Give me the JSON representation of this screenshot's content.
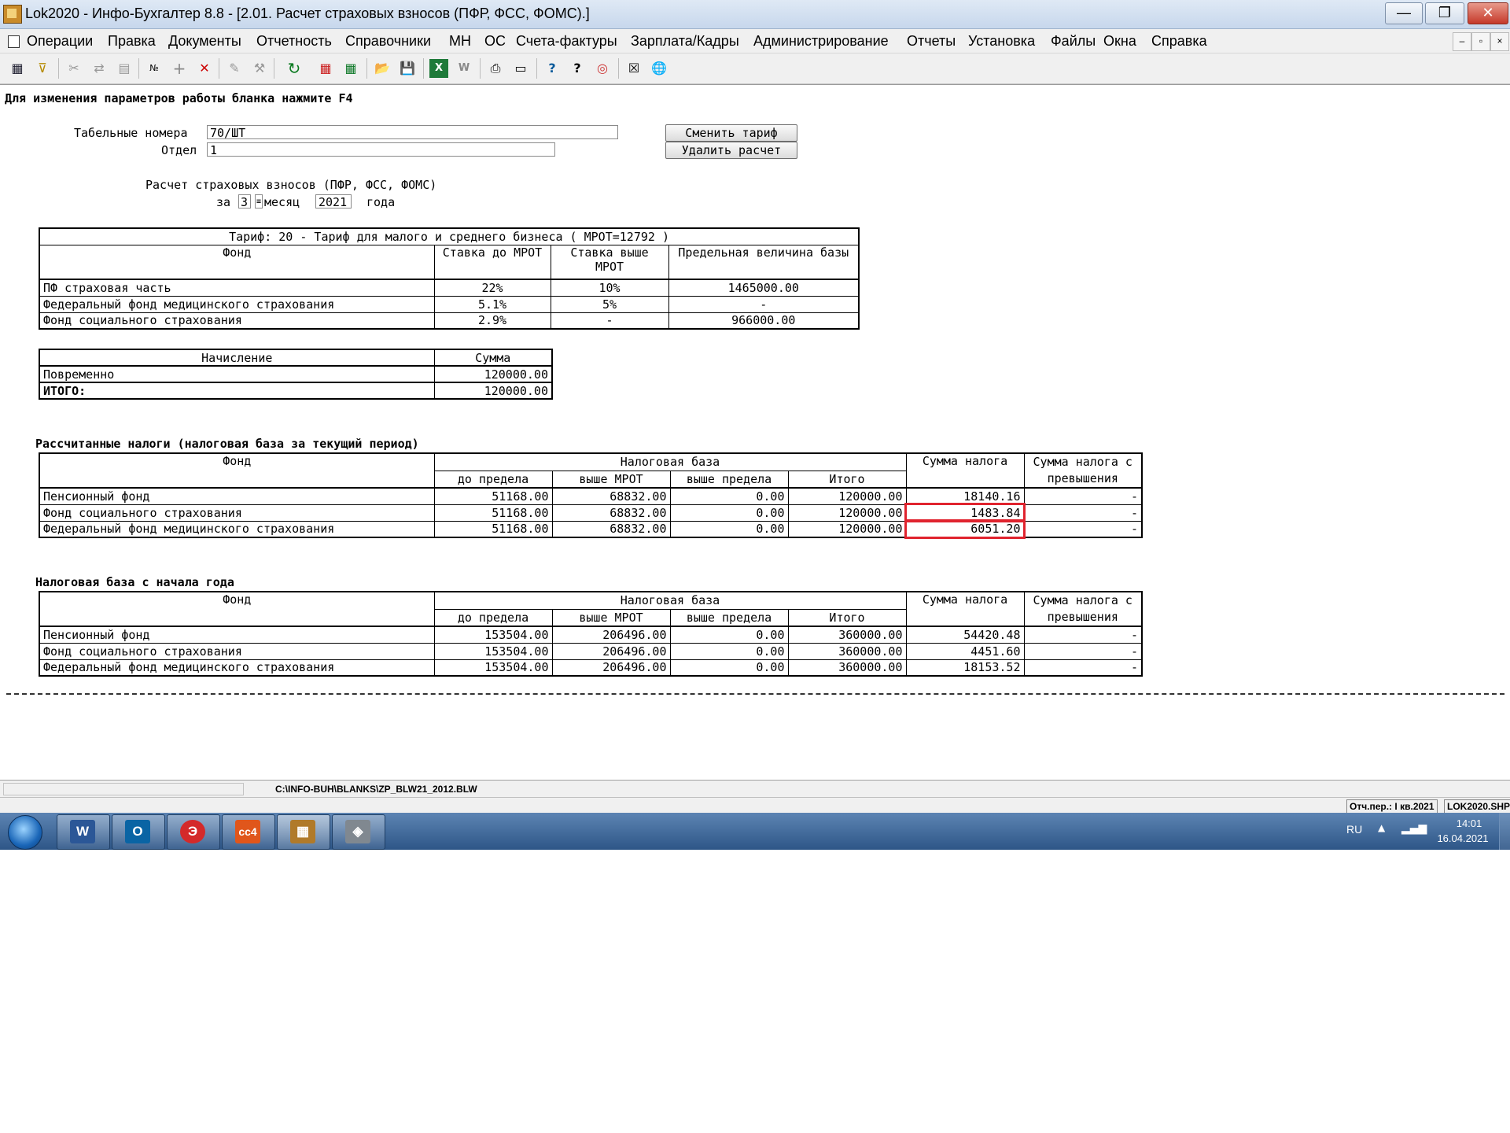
{
  "window": {
    "title": "Lok2020 - Инфо-Бухгалтер 8.8 - [2.01.   Расчет страховых взносов (ПФР, ФСС, ФОМС).]",
    "min_glyph": "—",
    "max_glyph": "❐",
    "close_glyph": "✕"
  },
  "menu": {
    "items": [
      "Операции",
      "Правка",
      "Документы",
      "Отчетность",
      "Справочники",
      "МН",
      "ОС",
      "Счета-фактуры",
      "Зарплата/Кадры",
      "Администрирование",
      "Отчеты",
      "Установка",
      "Файлы",
      "Окна",
      "Справка"
    ],
    "mdi": [
      "–",
      "▫",
      "×"
    ]
  },
  "toolbar": {
    "icons": [
      "grid-icon",
      "filter-icon",
      "cut-icon",
      "move-icon",
      "paste-icon",
      "number-icon",
      "add-icon",
      "delete-icon",
      "tool-a-icon",
      "tool-b-icon",
      "refresh-icon",
      "calendar-icon",
      "calculator-icon",
      "open-folder-icon",
      "save-icon",
      "excel-icon",
      "word-icon",
      "print-icon",
      "preview-icon",
      "help-icon",
      "context-help-icon",
      "compass-icon",
      "close-doc-icon",
      "web-icon"
    ],
    "glyphs": [
      "▦",
      "⊽",
      "✂",
      "⇄",
      "▤",
      "№",
      "+",
      "✕",
      "✎",
      "⚒",
      "↻",
      "▦",
      "▦",
      "📂",
      "💾",
      "X",
      "W",
      "⎙",
      "▭",
      "?",
      "?",
      "◎",
      "☒",
      "🌐"
    ]
  },
  "form": {
    "hint": "Для изменения параметров работы бланка нажмите F4",
    "tab_label": "Табельные номера",
    "tab_value": "70/ШТ",
    "dept_label": "Отдел",
    "dept_value": "1",
    "btn_change_tariff": "Сменить тариф",
    "btn_delete_calc": "Удалить расчет",
    "calc_title": "Расчет страховых взносов (ПФР, ФСС, ФОМС)",
    "za": "за",
    "month": "3",
    "mesyac": "месяц",
    "year": "2021",
    "goda": "года"
  },
  "tariff_table": {
    "title": "Тариф: 20 - Тариф для малого и среднего бизнеса ( МРОТ=12792 )",
    "headers": [
      "Фонд",
      "Ставка до МРОТ",
      "Ставка выше МРОТ",
      "Предельная величина базы"
    ],
    "rows": [
      [
        "ПФ страховая часть",
        "22%",
        "10%",
        "1465000.00"
      ],
      [
        "Федеральный фонд медицинского страхования",
        "5.1%",
        "5%",
        "-"
      ],
      [
        "Фонд социального страхования",
        "2.9%",
        "-",
        "966000.00"
      ]
    ]
  },
  "accrual_table": {
    "headers": [
      "Начисление",
      "Сумма"
    ],
    "rows": [
      [
        "Повременно",
        "120000.00"
      ]
    ],
    "total": [
      "ИТОГО:",
      "120000.00"
    ]
  },
  "taxes_current": {
    "title": "Рассчитанные налоги (налоговая база за текущий период)",
    "h_fund": "Фонд",
    "h_base": "Налоговая база",
    "h_sum": "Сумма налога",
    "h_excess": "Сумма налога с превышения",
    "sub": [
      "до предела",
      "выше МРОТ",
      "выше предела",
      "Итого"
    ],
    "rows": [
      [
        "Пенсионный фонд",
        "51168.00",
        "68832.00",
        "0.00",
        "120000.00",
        "18140.16",
        "-"
      ],
      [
        "Фонд социального страхования",
        "51168.00",
        "68832.00",
        "0.00",
        "120000.00",
        "1483.84",
        "-"
      ],
      [
        "Федеральный фонд медицинского страхования",
        "51168.00",
        "68832.00",
        "0.00",
        "120000.00",
        "6051.20",
        "-"
      ]
    ]
  },
  "taxes_ytd": {
    "title": "Налоговая база с начала года",
    "h_fund": "Фонд",
    "h_base": "Налоговая база",
    "h_sum": "Сумма налога",
    "h_excess": "Сумма налога с превышения",
    "sub": [
      "до предела",
      "выше МРОТ",
      "выше предела",
      "Итого"
    ],
    "rows": [
      [
        "Пенсионный фонд",
        "153504.00",
        "206496.00",
        "0.00",
        "360000.00",
        "54420.48",
        "-"
      ],
      [
        "Фонд социального страхования",
        "153504.00",
        "206496.00",
        "0.00",
        "360000.00",
        "4451.60",
        "-"
      ],
      [
        "Федеральный фонд медицинского страхования",
        "153504.00",
        "206496.00",
        "0.00",
        "360000.00",
        "18153.52",
        "-"
      ]
    ]
  },
  "status": {
    "path": "C:\\INFO-BUH\\BLANKS\\ZP_BLW21_2012.BLW",
    "period": "Отч.пер.: I кв.2021",
    "file": "LOK2020.SHP"
  },
  "taskbar": {
    "apps": [
      {
        "name": "word-icon",
        "glyph": "W",
        "color": "#2b5797"
      },
      {
        "name": "outlook-icon",
        "glyph": "O",
        "color": "#0a64a4"
      },
      {
        "name": "app-e-icon",
        "glyph": "Э",
        "color": "#d42a2a"
      },
      {
        "name": "cc4-icon",
        "glyph": "cc4",
        "color": "#e0561b"
      },
      {
        "name": "abacus-icon",
        "glyph": "▦",
        "color": "#b07a2a"
      },
      {
        "name": "disk-icon",
        "glyph": "◈",
        "color": "#808890"
      }
    ],
    "lang": "RU",
    "time": "14:01",
    "date": "16.04.2021"
  }
}
